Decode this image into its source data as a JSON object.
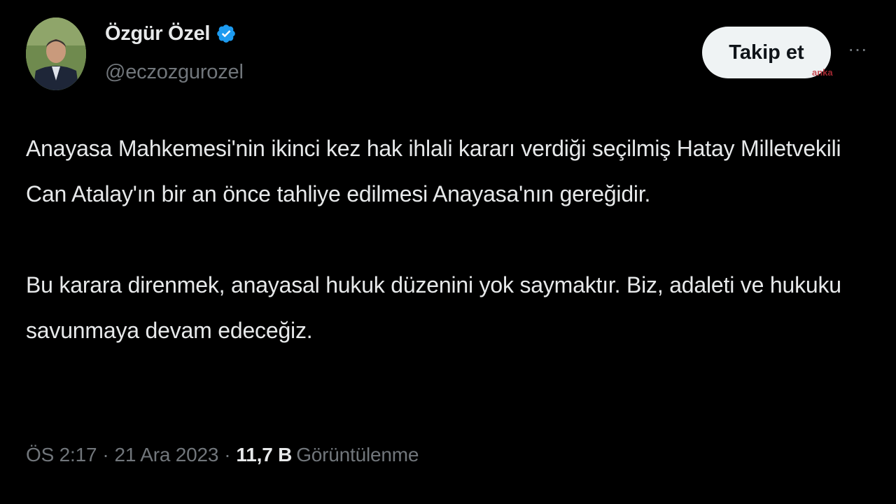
{
  "author": {
    "display_name": "Özgür Özel",
    "handle": "@eczozgurozel",
    "verified_icon": "verified-badge-icon",
    "avatar": "avatar-photo"
  },
  "actions": {
    "follow_label": "Takip et",
    "more_label": "···"
  },
  "watermark": "anka",
  "tweet": {
    "paragraphs": [
      "Anayasa Mahkemesi'nin ikinci kez hak ihlali kararı verdiği seçilmiş Hatay Milletvekili Can Atalay'ın bir an önce tahliye edilmesi Anayasa'nın gereğidir.",
      "Bu karara direnmek, anayasal hukuk düzenini yok saymaktır. Biz, adaleti ve hukuku savunmaya devam edeceğiz."
    ]
  },
  "meta": {
    "time": "ÖS 2:17",
    "separator": "·",
    "date": "21 Ara 2023",
    "views_count": "11,7 B",
    "views_label": "Görüntülenme"
  },
  "colors": {
    "background": "#000000",
    "text_primary": "#e7e9ea",
    "text_secondary": "#71767b",
    "verified_blue": "#1d9bf0",
    "follow_button_bg": "#eff3f4"
  }
}
